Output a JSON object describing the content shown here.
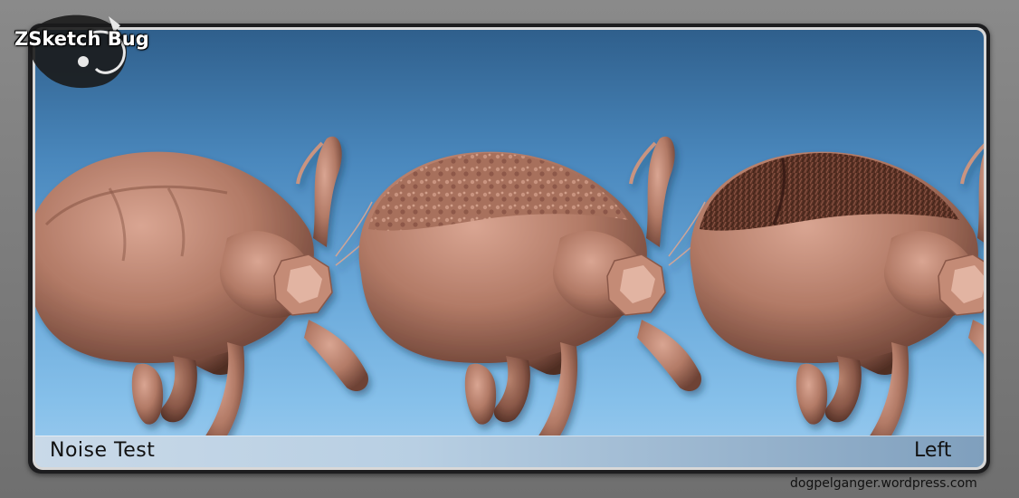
{
  "header": {
    "title": "ZSketch Bug"
  },
  "panel": {
    "left_label": "Noise Test",
    "right_label": "Left"
  },
  "footer": {
    "url": "dogpelganger.wordpress.com"
  },
  "colors": {
    "bug_skin": "#b27a66",
    "background_top": "#2f5f8c",
    "background_bottom": "#9ccbee"
  }
}
